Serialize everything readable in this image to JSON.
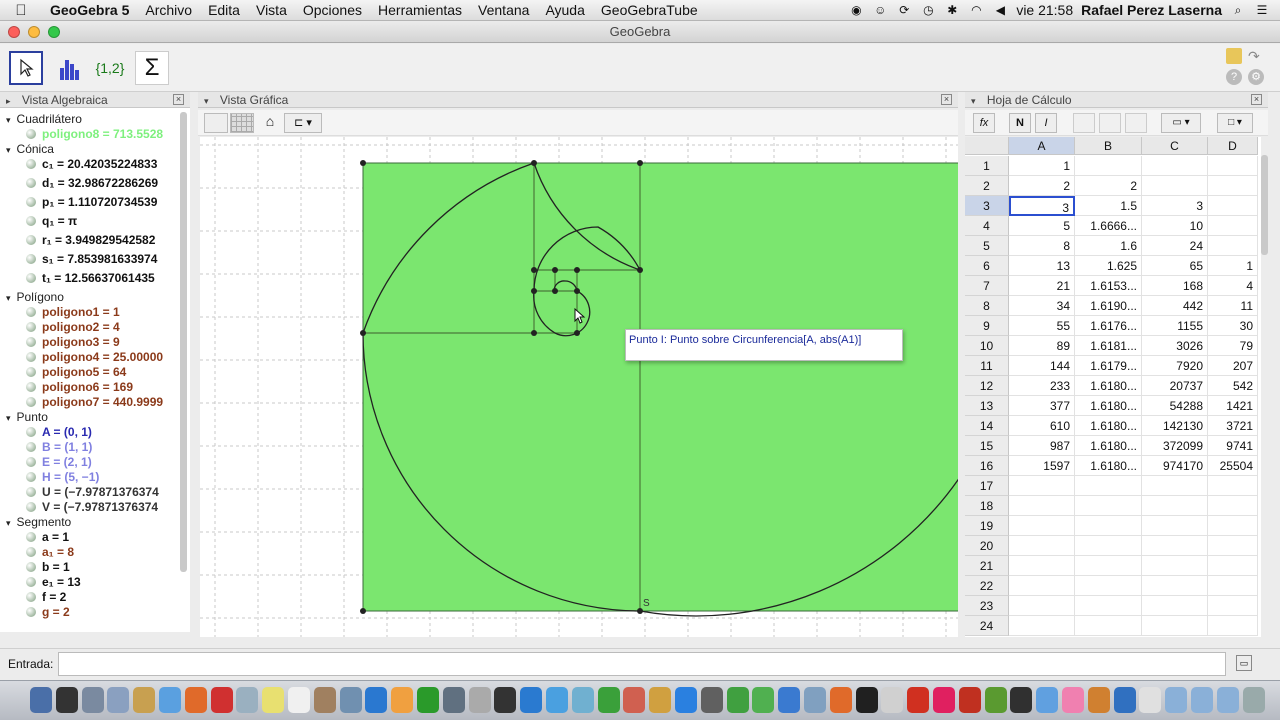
{
  "menubar": {
    "apple": "",
    "app": "GeoGebra 5",
    "items": [
      "Archivo",
      "Edita",
      "Vista",
      "Opciones",
      "Herramientas",
      "Ventana",
      "Ayuda",
      "GeoGebraTube"
    ],
    "clock": "vie 21:58",
    "user": "Rafael Perez Laserna"
  },
  "window": {
    "title": "GeoGebra"
  },
  "toolbar": {
    "tool_3": "{1,2}",
    "tool_4": "Σ"
  },
  "algebra": {
    "title": "Vista Algebraica",
    "categories": [
      {
        "name": "Cuadrilátero",
        "items": [
          {
            "text": "poligono8 = 713.5528",
            "color": "#7ef07e"
          }
        ]
      },
      {
        "name": "Cónica",
        "items": [
          {
            "text": "c₁ = 20.42035224833",
            "color": "#111"
          },
          {
            "text": "d₁ = 32.98672286269",
            "color": "#111"
          },
          {
            "text": "p₁ = 1.110720734539",
            "color": "#111"
          },
          {
            "text": "q₁ = π",
            "color": "#111"
          },
          {
            "text": "r₁ = 3.949829542582",
            "color": "#111"
          },
          {
            "text": "s₁ = 7.853981633974",
            "color": "#111"
          },
          {
            "text": "t₁ = 12.56637061435",
            "color": "#111"
          }
        ]
      },
      {
        "name": "Polígono",
        "items": [
          {
            "text": "poligono1 = 1",
            "color": "#8b3a1a"
          },
          {
            "text": "poligono2 = 4",
            "color": "#8b3a1a"
          },
          {
            "text": "poligono3 = 9",
            "color": "#8b3a1a"
          },
          {
            "text": "poligono4 = 25.00000",
            "color": "#8b3a1a"
          },
          {
            "text": "poligono5 = 64",
            "color": "#8b3a1a"
          },
          {
            "text": "poligono6 = 169",
            "color": "#8b3a1a"
          },
          {
            "text": "poligono7 = 440.9999",
            "color": "#8b3a1a"
          }
        ]
      },
      {
        "name": "Punto",
        "items": [
          {
            "text": "A = (0, 1)",
            "color": "#2a2ab0"
          },
          {
            "text": "B = (1, 1)",
            "color": "#8080e0"
          },
          {
            "text": "E = (2, 1)",
            "color": "#8080e0"
          },
          {
            "text": "H = (5, −1)",
            "color": "#8080e0"
          },
          {
            "text": "U = (−7.97871376374",
            "color": "#333"
          },
          {
            "text": "V = (−7.97871376374",
            "color": "#333"
          }
        ]
      },
      {
        "name": "Segmento",
        "items": [
          {
            "text": "a = 1",
            "color": "#111"
          },
          {
            "text": "a₁ = 8",
            "color": "#8b3a1a"
          },
          {
            "text": "b = 1",
            "color": "#111"
          },
          {
            "text": "e₁ = 13",
            "color": "#111"
          },
          {
            "text": "f = 2",
            "color": "#111"
          },
          {
            "text": "g = 2",
            "color": "#8b3a1a"
          }
        ]
      }
    ]
  },
  "graphics": {
    "title": "Vista Gráfica",
    "tooltip": "Punto I: Punto sobre Circunferencia[A, abs(A1)]",
    "label_s": "S",
    "fill": "#7be66f"
  },
  "spreadsheet": {
    "title": "Hoja de Cálculo",
    "fx": "fx",
    "bold": "N",
    "italic": "I",
    "columns": [
      "A",
      "B",
      "C",
      "D"
    ],
    "rows": [
      [
        "1",
        "",
        "",
        ""
      ],
      [
        "2",
        "2",
        "",
        ""
      ],
      [
        "3",
        "1.5",
        "3",
        ""
      ],
      [
        "5",
        "1.6666...",
        "10",
        ""
      ],
      [
        "8",
        "1.6",
        "24",
        ""
      ],
      [
        "13",
        "1.625",
        "65",
        "1"
      ],
      [
        "21",
        "1.6153...",
        "168",
        "4"
      ],
      [
        "34",
        "1.6190...",
        "442",
        "11"
      ],
      [
        "55",
        "1.6176...",
        "1155",
        "30"
      ],
      [
        "89",
        "1.6181...",
        "3026",
        "79"
      ],
      [
        "144",
        "1.6179...",
        "7920",
        "207"
      ],
      [
        "233",
        "1.6180...",
        "20737",
        "542"
      ],
      [
        "377",
        "1.6180...",
        "54288",
        "1421"
      ],
      [
        "610",
        "1.6180...",
        "142130",
        "3721"
      ],
      [
        "987",
        "1.6180...",
        "372099",
        "9741"
      ],
      [
        "1597",
        "1.6180...",
        "974170",
        "25504"
      ],
      [
        "",
        "",
        "",
        ""
      ],
      [
        "",
        "",
        "",
        ""
      ],
      [
        "",
        "",
        "",
        ""
      ],
      [
        "",
        "",
        "",
        ""
      ],
      [
        "",
        "",
        "",
        ""
      ],
      [
        "",
        "",
        "",
        ""
      ],
      [
        "",
        "",
        "",
        ""
      ],
      [
        "",
        "",
        "",
        ""
      ]
    ]
  },
  "input": {
    "label": "Entrada:",
    "value": ""
  }
}
